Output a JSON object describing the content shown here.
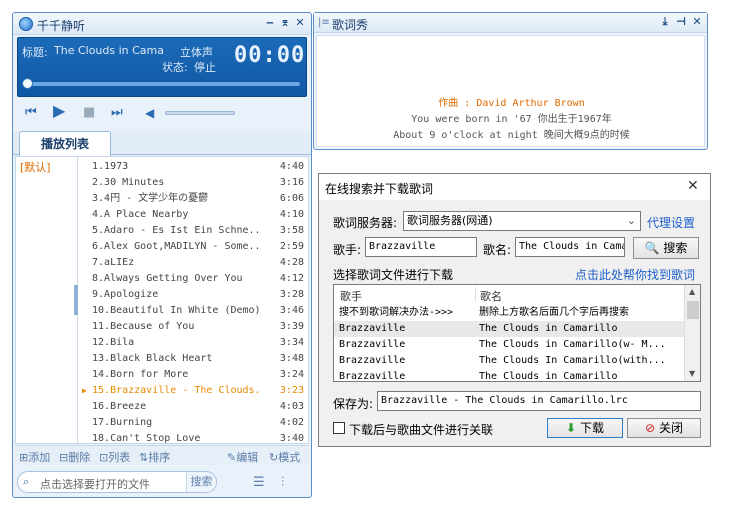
{
  "player": {
    "app_title": "千千静听",
    "title_label": "标题:",
    "track_title": "The Clouds in Cama",
    "stereo": "立体声",
    "status_label": "状态:",
    "status": "停止",
    "time": "00:00",
    "tab_playlist": "播放列表",
    "category_default": "[默认]",
    "songs": [
      {
        "n": "1.",
        "title": "1973",
        "dur": "4:40"
      },
      {
        "n": "2.",
        "title": "30 Minutes",
        "dur": "3:16"
      },
      {
        "n": "3.",
        "title": "4円 - 文学少年の憂鬱",
        "dur": "6:06"
      },
      {
        "n": "4.",
        "title": "A Place Nearby",
        "dur": "4:10"
      },
      {
        "n": "5.",
        "title": "Adaro - Es Ist Ein Schne...",
        "dur": "3:58"
      },
      {
        "n": "6.",
        "title": "Alex Goot,MADILYN - Some...",
        "dur": "2:59"
      },
      {
        "n": "7.",
        "title": "aLIEz",
        "dur": "4:28"
      },
      {
        "n": "8.",
        "title": "Always Getting Over You",
        "dur": "4:12"
      },
      {
        "n": "9.",
        "title": "Apologize",
        "dur": "3:28"
      },
      {
        "n": "10.",
        "title": "Beautiful In White (Demo)",
        "dur": "3:46"
      },
      {
        "n": "11.",
        "title": "Because of You",
        "dur": "3:39"
      },
      {
        "n": "12.",
        "title": "Bila",
        "dur": "3:34"
      },
      {
        "n": "13.",
        "title": "Black Black Heart",
        "dur": "3:48"
      },
      {
        "n": "14.",
        "title": "Born for More",
        "dur": "3:24"
      },
      {
        "n": "15.",
        "title": "Brazzaville - The Clouds...",
        "dur": "3:23"
      },
      {
        "n": "16.",
        "title": "Breeze",
        "dur": "4:03"
      },
      {
        "n": "17.",
        "title": "Burning",
        "dur": "4:02"
      },
      {
        "n": "18.",
        "title": "Can't Stop Love",
        "dur": "3:40"
      }
    ],
    "current_index": 14,
    "toolbar": {
      "add": "添加",
      "remove": "删除",
      "list": "列表",
      "sort": "排序",
      "edit": "编辑",
      "mode": "模式"
    },
    "search_placeholder": "点击选择要打开的文件",
    "search_button": "搜索"
  },
  "lyrics": {
    "title": "歌词秀",
    "lines": [
      {
        "text": "作曲 : David Arthur Brown",
        "color": "#e06a00"
      },
      {
        "text": "You were born in '67 你出生于1967年",
        "color": "#555555"
      },
      {
        "text": "About 9 o'clock at night 晚间大概9点的时候",
        "color": "#555555"
      }
    ]
  },
  "dialog": {
    "title": "在线搜索并下载歌词",
    "server_label": "歌词服务器:",
    "server_value": "歌词服务器(网通)",
    "proxy_link": "代理设置",
    "artist_label": "歌手:",
    "artist_value": "Brazzaville",
    "song_label": "歌名:",
    "song_value": "The Clouds in Cama",
    "search_button": "搜索",
    "select_label": "选择歌词文件进行下载",
    "help_link": "点击此处帮你找到歌词",
    "col_artist": "歌手",
    "col_song": "歌名",
    "rows": [
      {
        "artist": "搜不到歌词解决办法->>>",
        "song": "删除上方歌名后面几个字后再搜索"
      },
      {
        "artist": "Brazzaville",
        "song": "The Clouds in Camarillo"
      },
      {
        "artist": "Brazzaville",
        "song": "The Clouds in Camarillo(w- M..."
      },
      {
        "artist": "Brazzaville",
        "song": "The Clouds In Camarillo(with..."
      },
      {
        "artist": "Brazzaville",
        "song": "The Clouds in Camarillo"
      }
    ],
    "save_label": "保存为:",
    "save_value": "Brazzaville - The Clouds in Camarillo.lrc",
    "assoc_label": "下载后与歌曲文件进行关联",
    "download_button": "下载",
    "close_button": "关闭"
  }
}
